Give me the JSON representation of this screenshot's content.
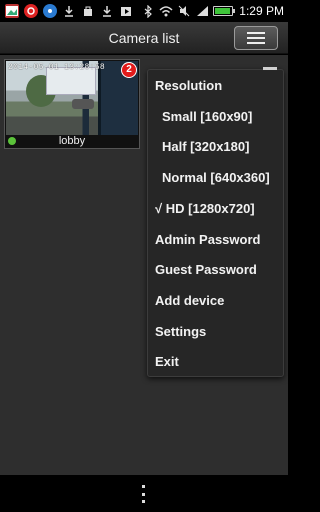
{
  "status_bar": {
    "time": "1:29",
    "ampm": "PM",
    "icons": [
      "image-notification-icon",
      "alert-notification-icon",
      "app-notification-icon",
      "download-icon",
      "bag-icon",
      "download-icon",
      "play-store-icon",
      "bluetooth-icon",
      "wifi-icon",
      "mute-icon",
      "signal-icon",
      "battery-icon"
    ],
    "battery_level": 0.9
  },
  "header": {
    "title": "Camera list",
    "menu_icon": "hamburger-menu-icon"
  },
  "cameras": [
    {
      "name": "lobby",
      "timestamp": "2014-05-01 13:28:58",
      "badge_count": "2",
      "status_color": "#5bc33a"
    }
  ],
  "menu": {
    "section_title": "Resolution",
    "resolutions": [
      {
        "label": "Small [160x90]"
      },
      {
        "label": "Half [320x180]"
      },
      {
        "label": "Normal [640x360]"
      },
      {
        "label": "√ HD [1280x720]"
      }
    ],
    "items": [
      {
        "label": "Admin Password"
      },
      {
        "label": "Guest Password"
      },
      {
        "label": "Add device"
      },
      {
        "label": "Settings"
      },
      {
        "label": "Exit"
      }
    ]
  },
  "nav": {
    "overflow_icon": "overflow-menu-icon"
  },
  "colors": {
    "badge": "#e21b1b",
    "online": "#5bc33a",
    "background": "#2e2e2e"
  }
}
